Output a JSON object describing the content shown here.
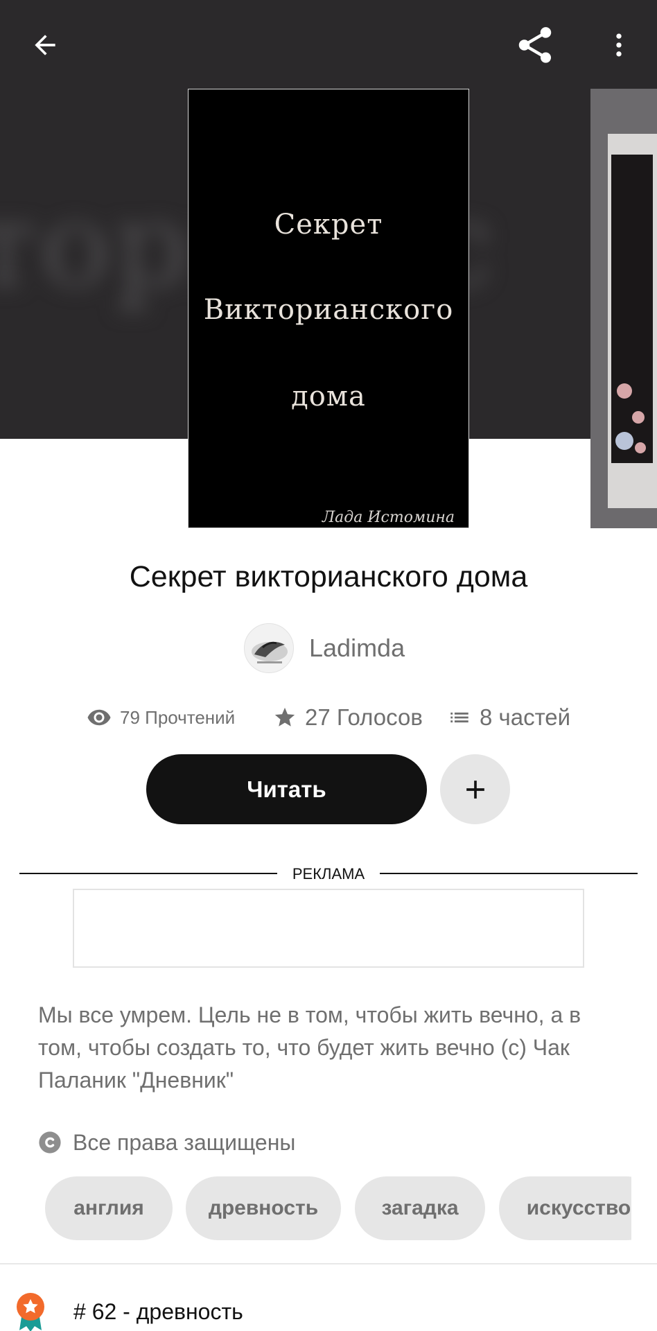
{
  "hero": {
    "blurred_text": "торианс"
  },
  "icons": {
    "back": "arrow-left-icon",
    "share": "share-icon",
    "more": "more-vertical-icon",
    "reads": "eye-icon",
    "votes": "star-icon",
    "parts": "list-icon",
    "add": "plus-icon",
    "rights": "copyright-icon",
    "rank": "award-ribbon-icon"
  },
  "cover": {
    "line1": "Секрет",
    "line2": "Викторианского",
    "line3": "дома",
    "author": "Лада Истомина"
  },
  "book": {
    "title": "Секрет викторианского дома",
    "author": "Ladimda"
  },
  "stats": {
    "reads": "79 Прочтений",
    "votes": "27 Голосов",
    "parts": "8 частей"
  },
  "actions": {
    "read_label": "Читать"
  },
  "ad": {
    "label": "РЕКЛАМА"
  },
  "description": "Мы все умрем. Цель не в том, чтобы жить вечно, а в том, чтобы создать то, что будет жить вечно (с) Чак Паланик \"Дневник\"",
  "rights": "Все права защищены",
  "tags": [
    "англия",
    "древность",
    "загадка",
    "искусство"
  ],
  "rank": "# 62 - древность",
  "colors": {
    "hero_bg": "#2b292b",
    "primary_button": "#121212",
    "secondary_text": "#6f6f6f",
    "chip_bg": "#e6e6e6",
    "rank_badge": "#f26a2b",
    "rank_ribbon": "#1a9c96"
  }
}
